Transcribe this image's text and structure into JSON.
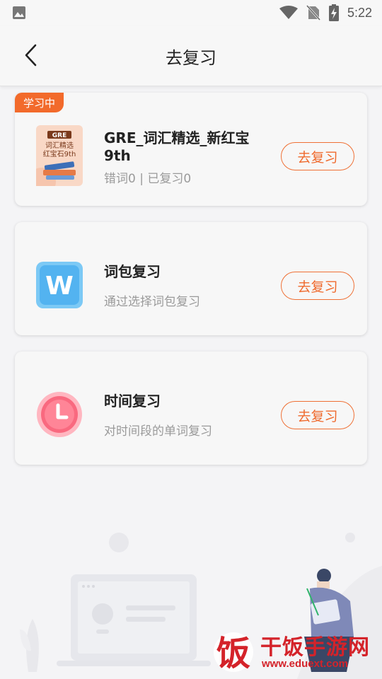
{
  "status_bar": {
    "time": "5:22",
    "icons": [
      "image-icon",
      "wifi-icon",
      "no-sim-icon",
      "battery-charging-icon"
    ]
  },
  "header": {
    "title": "去复习",
    "back_icon": "chevron-left-icon"
  },
  "cards": [
    {
      "badge": "学习中",
      "title": "GRE_词汇精选_新红宝9th",
      "subtitle": "错词0 | 已复习0",
      "button": "去复习",
      "thumbnail": {
        "tag": "GRE",
        "line1": "词汇精选",
        "line2": "红宝石9th"
      }
    },
    {
      "title": "词包复习",
      "subtitle": "通过选择词包复习",
      "button": "去复习",
      "icon_letter": "W"
    },
    {
      "title": "时间复习",
      "subtitle": "对时间段的单词复习",
      "button": "去复习"
    }
  ],
  "watermark": {
    "title": "干饭手游网",
    "url": "www.eduext.com",
    "logo_char": "饭"
  },
  "colors": {
    "accent": "#ef6a2d",
    "badge": "#f26a2b",
    "background": "#f4f4f6",
    "watermark": "#d4232a"
  }
}
